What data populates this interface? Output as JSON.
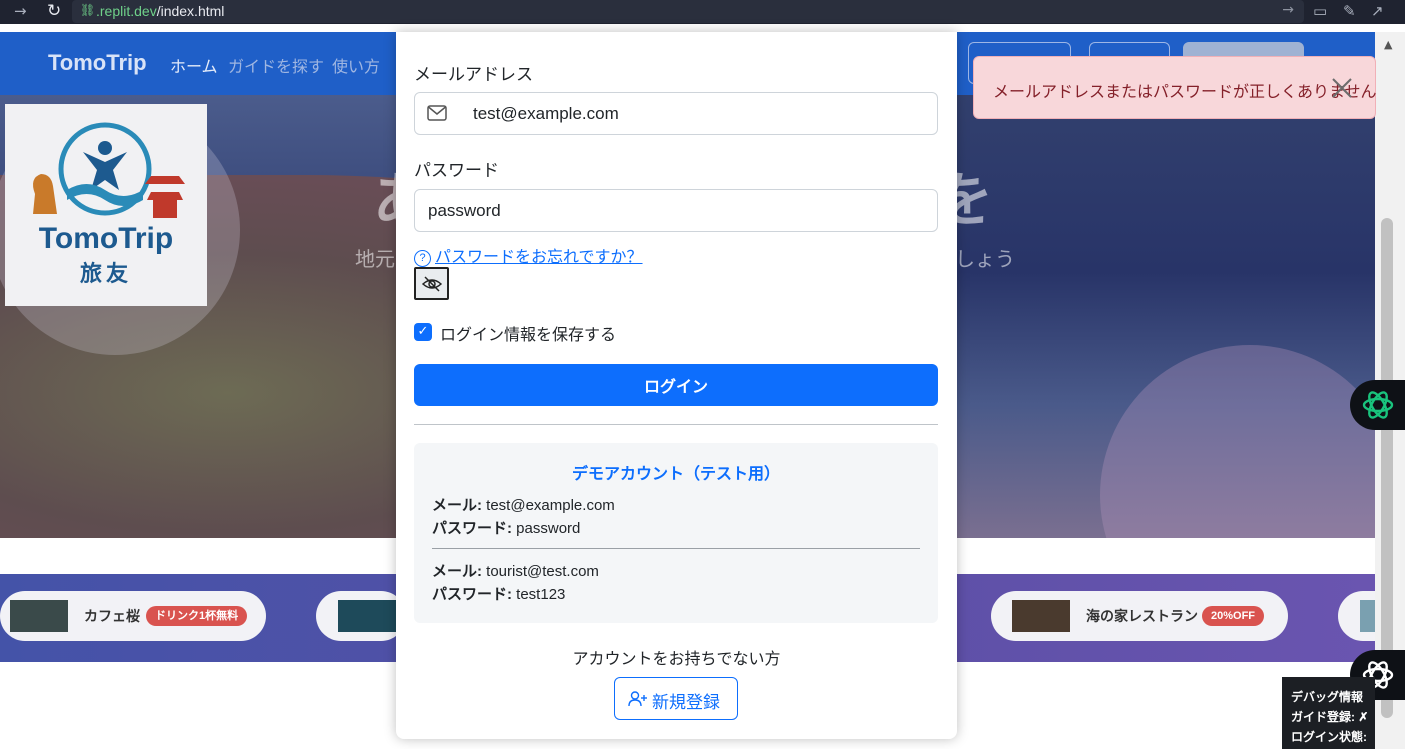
{
  "browser": {
    "url_domain": ".replit.dev",
    "url_path": "/index.html"
  },
  "site": {
    "brand": "TomoTrip",
    "nav": [
      "ホーム",
      "ガイドを探す",
      "使い方"
    ],
    "hero_title_left": "あ",
    "hero_title_right": "を",
    "hero_sub_left": "地元",
    "hero_sub_right": "しょう",
    "logo_en": "TomoTrip",
    "logo_jp": "旅友"
  },
  "promos": [
    {
      "name": "カフェ桜",
      "badge": "ドリンク1杯無料"
    },
    {
      "name": "海の家レストラン",
      "badge": "20%OFF"
    }
  ],
  "modal": {
    "email_label": "メールアドレス",
    "email_value": "test@example.com",
    "password_label": "パスワード",
    "password_value": "password",
    "forgot_link": "パスワードをお忘れですか？",
    "remember_label": "ログイン情報を保存する",
    "login_button": "ログイン",
    "demo": {
      "title": "デモアカウント（テスト用）",
      "accounts": [
        {
          "email_label": "メール:",
          "email": "test@example.com",
          "password_label": "パスワード:",
          "password": "password"
        },
        {
          "email_label": "メール:",
          "email": "tourist@test.com",
          "password_label": "パスワード:",
          "password": "test123"
        }
      ]
    },
    "no_account": "アカウントをお持ちでない方",
    "register_button": "新規登録"
  },
  "toast": {
    "message": "メールアドレスまたはパスワードが正しくありません"
  },
  "debug": {
    "title": "デバッグ情報",
    "guide_label": "ガイド登録: ✗",
    "login_label": "ログイン状態: ✗"
  },
  "colors": {
    "primary": "#0d6efd",
    "toast_bg": "#f8d7da",
    "toast_text": "#842029",
    "nav_bg": "#1f5fc8"
  }
}
